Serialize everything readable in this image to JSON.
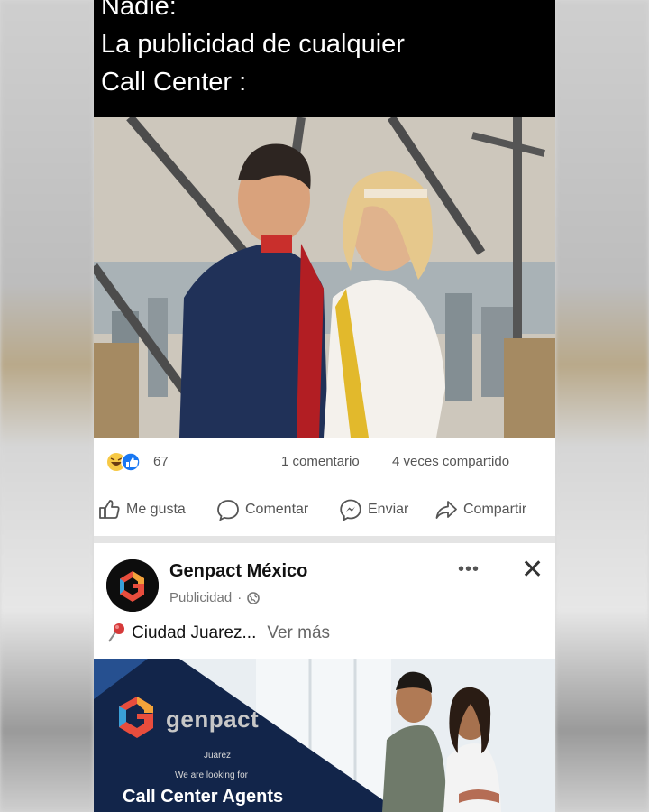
{
  "meme": {
    "caption_lines": [
      "Nadie:",
      "La publicidad de cualquier",
      "Call Center :"
    ]
  },
  "post": {
    "reaction_count": "67",
    "comments": "1 comentario",
    "shares": "4 veces compartido",
    "actions": {
      "like": "Me gusta",
      "comment": "Comentar",
      "send": "Enviar",
      "share": "Compartir"
    }
  },
  "ad": {
    "advertiser": "Genpact México",
    "sponsored_label": "Publicidad",
    "text": "Ciudad Juarez...",
    "see_more": "Ver más",
    "image": {
      "brand": "genpact",
      "city": "Juarez",
      "hiring": "We are looking for",
      "headline": "Call Center Agents"
    }
  },
  "icons": [
    "haha-icon",
    "like-reaction-icon",
    "thumbs-up-icon",
    "comment-bubble-icon",
    "messenger-icon",
    "share-arrow-icon",
    "globe-icon",
    "pin-icon",
    "more-options-icon",
    "close-icon",
    "genpact-logo"
  ],
  "colors": {
    "caption_bg": "#000000",
    "facebook_blue": "#1877f2",
    "ad_banner": "#12254a"
  }
}
